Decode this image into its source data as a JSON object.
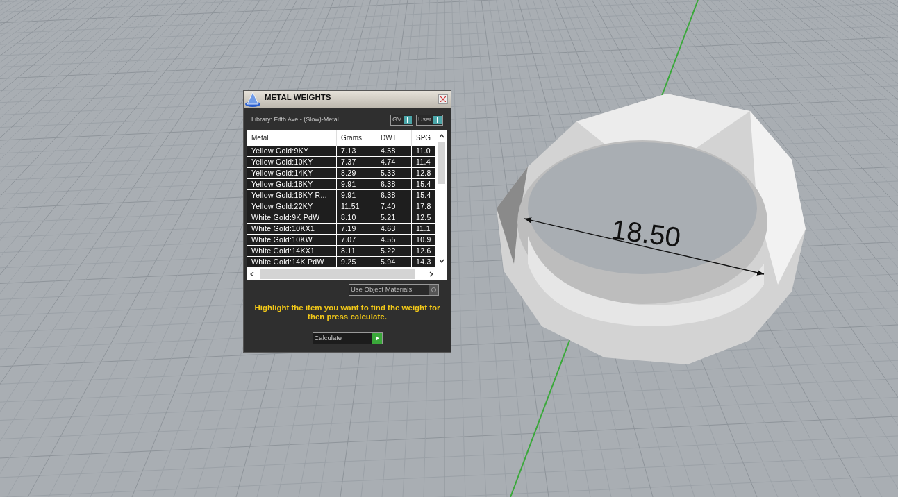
{
  "viewport": {
    "dimension": "18.50"
  },
  "dialog": {
    "title": "METAL WEIGHTS",
    "library": "Library: Fifth Ave - (Slow)-Metal",
    "toggles": [
      {
        "label": "GV",
        "on": true
      },
      {
        "label": "User",
        "on": true
      }
    ],
    "table": {
      "columns": [
        "Metal",
        "Grams",
        "DWT",
        "SPG"
      ],
      "rows": [
        [
          "Yellow Gold:9KY",
          "7.13",
          "4.58",
          "11.0"
        ],
        [
          "Yellow Gold:10KY",
          "7.37",
          "4.74",
          "11.4"
        ],
        [
          "Yellow Gold:14KY",
          "8.29",
          "5.33",
          "12.8"
        ],
        [
          "Yellow Gold:18KY",
          "9.91",
          "6.38",
          "15.4"
        ],
        [
          "Yellow Gold:18KY R...",
          "9.91",
          "6.38",
          "15.4"
        ],
        [
          "Yellow Gold:22KY",
          "11.51",
          "7.40",
          "17.8"
        ],
        [
          "White Gold:9K PdW",
          "8.10",
          "5.21",
          "12.5"
        ],
        [
          "White Gold:10KX1",
          "7.19",
          "4.63",
          "11.1"
        ],
        [
          "White Gold:10KW",
          "7.07",
          "4.55",
          "10.9"
        ],
        [
          "White Gold:14KX1",
          "8.11",
          "5.22",
          "12.6"
        ],
        [
          "White Gold:14K PdW",
          "9.25",
          "5.94",
          "14.3"
        ]
      ]
    },
    "materials_toggle": {
      "label": "Use Object Materials",
      "on": false
    },
    "hint": "Highlight the item you want to find the weight for then press calculate.",
    "button": "Calculate"
  }
}
